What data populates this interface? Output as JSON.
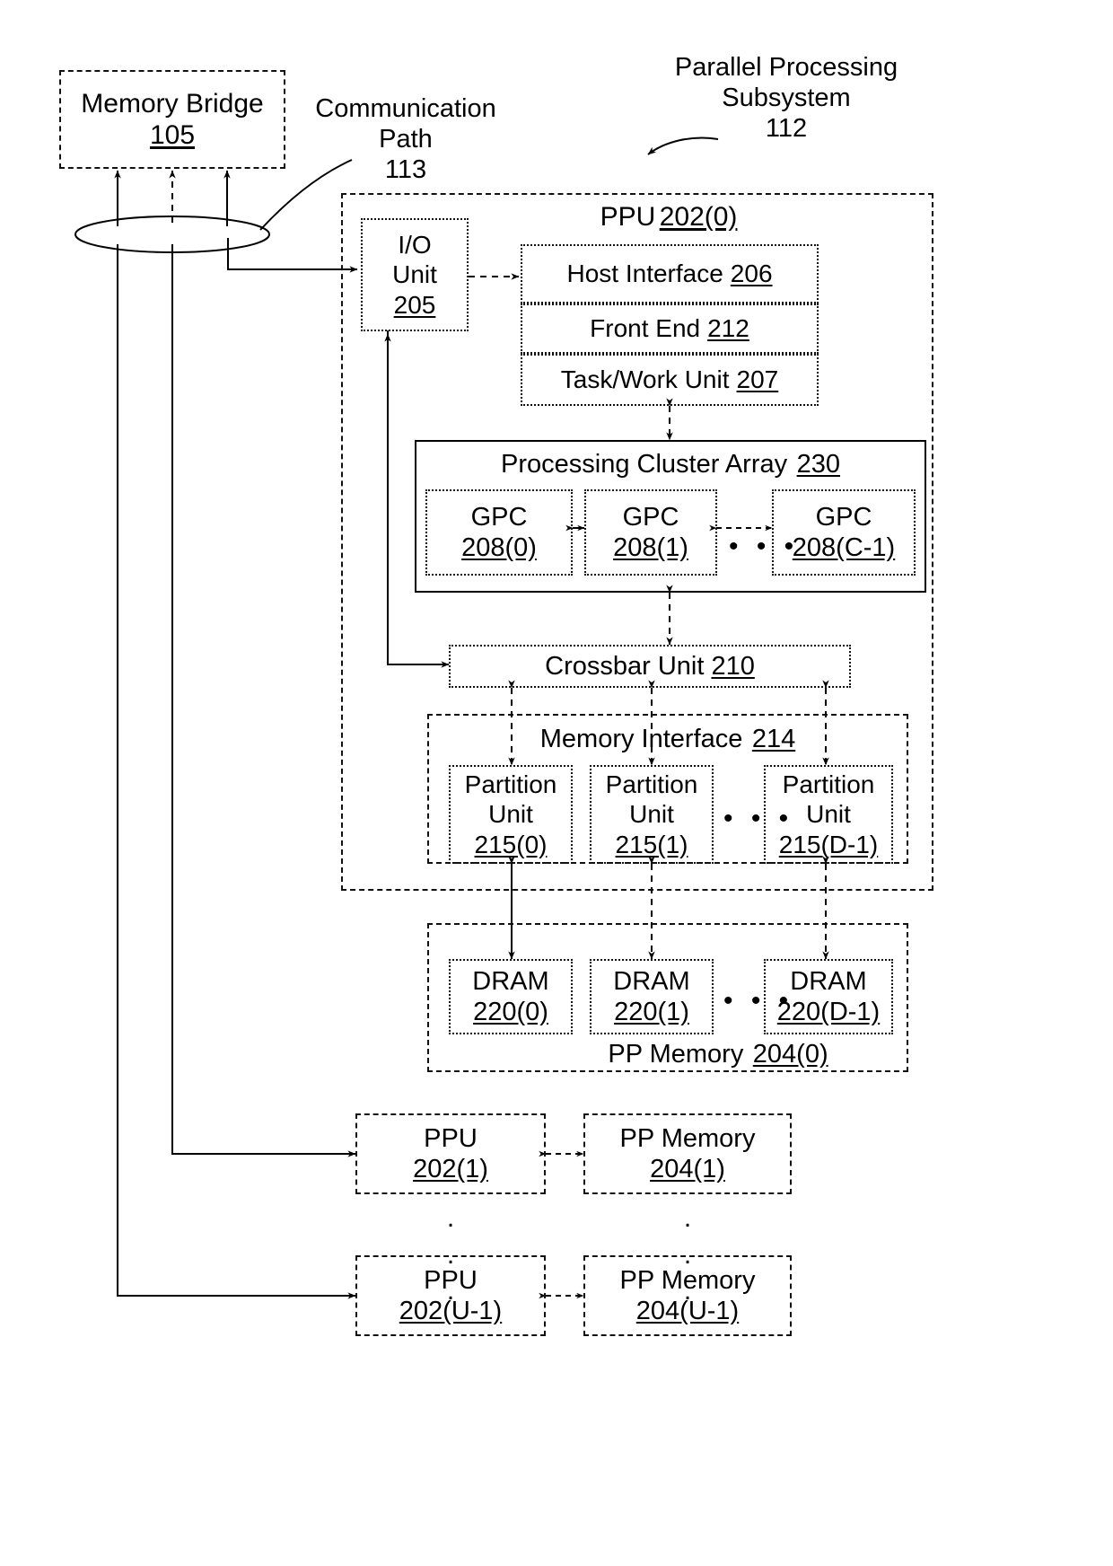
{
  "figure": {
    "type": "patent-block-diagram",
    "title": "Parallel Processing Subsystem block diagram"
  },
  "labels": {
    "memory_bridge": {
      "name": "Memory Bridge",
      "ref": "105"
    },
    "communication_path": {
      "line1": "Communication",
      "line2": "Path",
      "ref": "113"
    },
    "parallel_processing_subsystem": {
      "line1": "Parallel Processing",
      "line2": "Subsystem",
      "ref": "112"
    },
    "ppu0": {
      "name": "PPU",
      "ref": "202(0)"
    },
    "io_unit": {
      "line1": "I/O",
      "line2": "Unit",
      "ref": "205"
    },
    "host_interface": {
      "name": "Host Interface",
      "ref": "206"
    },
    "front_end": {
      "name": "Front End",
      "ref": "212"
    },
    "task_work_unit": {
      "name": "Task/Work Unit",
      "ref": "207"
    },
    "processing_cluster_array": {
      "name": "Processing Cluster Array",
      "ref": "230"
    },
    "crossbar_unit": {
      "name": "Crossbar Unit",
      "ref": "210"
    },
    "memory_interface": {
      "name": "Memory Interface",
      "ref": "214"
    },
    "pp_memory_0": {
      "name": "PP Memory",
      "ref": "204(0)"
    }
  },
  "gpcs": [
    {
      "name": "GPC",
      "ref": "208(0)"
    },
    {
      "name": "GPC",
      "ref": "208(1)"
    },
    {
      "name": "GPC",
      "ref": "208(C-1)"
    }
  ],
  "partition_units": [
    {
      "line1": "Partition",
      "line2": "Unit",
      "ref": "215(0)"
    },
    {
      "line1": "Partition",
      "line2": "Unit",
      "ref": "215(1)"
    },
    {
      "line1": "Partition",
      "line2": "Unit",
      "ref": "215(D-1)"
    }
  ],
  "drams": [
    {
      "name": "DRAM",
      "ref": "220(0)"
    },
    {
      "name": "DRAM",
      "ref": "220(1)"
    },
    {
      "name": "DRAM",
      "ref": "220(D-1)"
    }
  ],
  "additional_ppus": [
    {
      "ppu_name": "PPU",
      "ppu_ref": "202(1)",
      "mem_name": "PP Memory",
      "mem_ref": "204(1)"
    },
    {
      "ppu_name": "PPU",
      "ppu_ref": "202(U-1)",
      "mem_name": "PP Memory",
      "mem_ref": "204(U-1)"
    }
  ],
  "ellipses": {
    "horizontal": "• • •",
    "vertical_dot": "."
  },
  "colors": {
    "ink": "#000000",
    "background": "#ffffff"
  }
}
